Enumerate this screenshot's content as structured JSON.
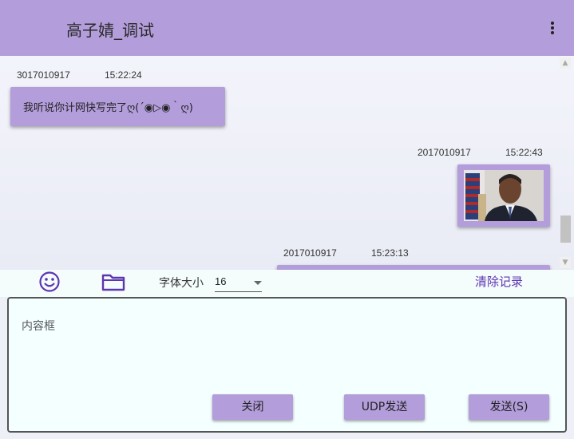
{
  "window": {
    "title": "高子婧_调试",
    "menu_icon": "more-vert-icon"
  },
  "messages": [
    {
      "sender": "3017010917",
      "time": "15:22:24",
      "text": "我听说你计网快写完了ღ(´◉▷◉｀ღ)",
      "side": "left",
      "type": "text"
    },
    {
      "sender": "2017010917",
      "time": "15:22:43",
      "type": "image",
      "side": "right",
      "image_desc": "portrait-photo"
    },
    {
      "sender": "2017010917",
      "time": "15:23:13",
      "type": "text",
      "side": "right",
      "text": ""
    }
  ],
  "toolbar": {
    "emoji_icon": "smile-icon",
    "folder_icon": "folder-icon",
    "font_size_label": "字体大小",
    "font_size_value": "16",
    "clear_label": "清除记录"
  },
  "input": {
    "placeholder": "内容框",
    "value": ""
  },
  "buttons": {
    "close": "关闭",
    "udp_send": "UDP发送",
    "send": "发送(S)"
  },
  "colors": {
    "accent": "#b39ddb",
    "clear_text": "#5e35b1",
    "input_bg": "#f4ffff"
  }
}
